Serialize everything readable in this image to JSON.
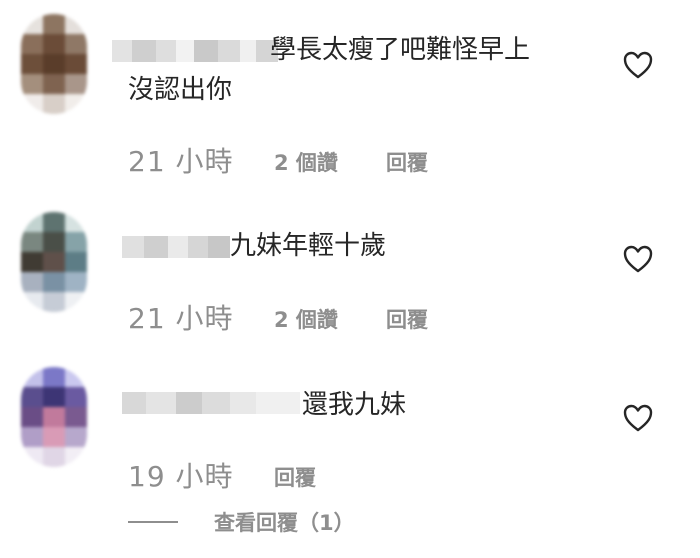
{
  "comments": [
    {
      "username_obscured": "",
      "text_line1": "學長太瘦了吧難怪早上",
      "text_line2": "沒認出你",
      "time": "21 小時",
      "likes": "2 個讚",
      "reply": "回覆"
    },
    {
      "username_obscured": "",
      "text_line1": "九妹年輕十歲",
      "time": "21 小時",
      "likes": "2 個讚",
      "reply": "回覆"
    },
    {
      "username_obscured": "",
      "text_line1": "還我九妹",
      "time": "19 小時",
      "reply": "回覆"
    }
  ],
  "view_replies": "查看回覆（1）",
  "icons": {
    "like": "heart-outline-icon"
  },
  "colors": {
    "text": "#262626",
    "secondary": "#8e8e8e"
  }
}
